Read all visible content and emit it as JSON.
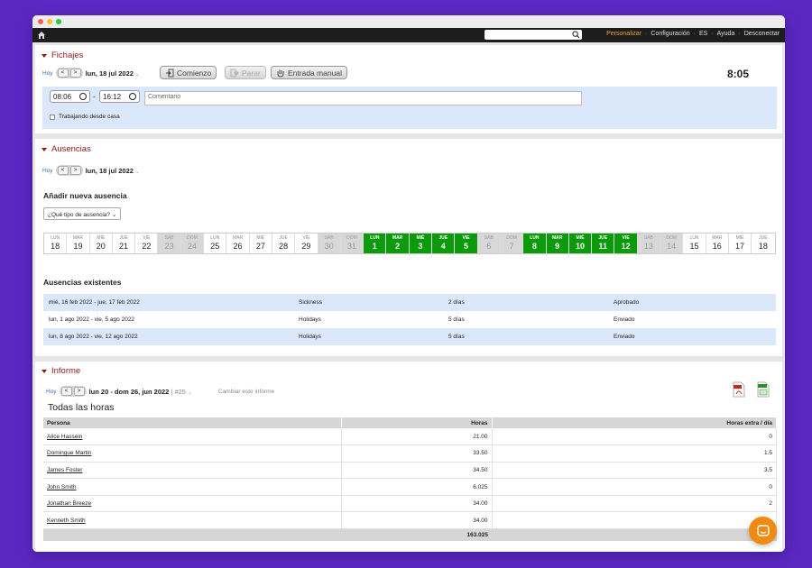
{
  "navbar": {
    "search_placeholder": "",
    "links": [
      "Personalizar",
      "Configuración",
      "ES",
      "Ayuda",
      "Desconectar"
    ],
    "separator": "·",
    "active_color": "#f0a030"
  },
  "fichajes": {
    "title": "Fichajes",
    "hoy": "Hoy",
    "prev": "<",
    "next": ">",
    "date": "lun, 18 jul 2022",
    "btn_comienzo": "Comienzo",
    "btn_parar": "Parar",
    "btn_entrada_manual": "Entrada manual",
    "clock": "8:05",
    "start_time": "08:06",
    "dash": "-",
    "end_time": "16:12",
    "comment_placeholder": "Comentario",
    "checkbox_label": "Trabajando desde casa"
  },
  "ausencias": {
    "title": "Ausencias",
    "hoy": "Hoy",
    "prev": "<",
    "next": ">",
    "date": "lun, 18 jul 2022",
    "add_heading": "Añadir nueva ausencia",
    "select_value": "¿Qué tipo de ausencia? ⌄",
    "calendar": [
      {
        "n": "LUN",
        "d": "18",
        "t": "n"
      },
      {
        "n": "MAR",
        "d": "19",
        "t": "n"
      },
      {
        "n": "MIÉ",
        "d": "20",
        "t": "n"
      },
      {
        "n": "JUE",
        "d": "21",
        "t": "n"
      },
      {
        "n": "VIE",
        "d": "22",
        "t": "n"
      },
      {
        "n": "SÁB",
        "d": "23",
        "t": "we"
      },
      {
        "n": "DOM",
        "d": "24",
        "t": "we"
      },
      {
        "n": "LUN",
        "d": "25",
        "t": "n"
      },
      {
        "n": "MAR",
        "d": "26",
        "t": "n"
      },
      {
        "n": "MIÉ",
        "d": "27",
        "t": "n"
      },
      {
        "n": "JUE",
        "d": "28",
        "t": "n"
      },
      {
        "n": "VIE",
        "d": "29",
        "t": "n"
      },
      {
        "n": "SÁB",
        "d": "30",
        "t": "we"
      },
      {
        "n": "DOM",
        "d": "31",
        "t": "we"
      },
      {
        "n": "LUN",
        "d": "1",
        "t": "sel"
      },
      {
        "n": "MAR",
        "d": "2",
        "t": "sel"
      },
      {
        "n": "MIÉ",
        "d": "3",
        "t": "sel"
      },
      {
        "n": "JUE",
        "d": "4",
        "t": "sel"
      },
      {
        "n": "VIE",
        "d": "5",
        "t": "sel"
      },
      {
        "n": "SÁB",
        "d": "6",
        "t": "we"
      },
      {
        "n": "DOM",
        "d": "7",
        "t": "we"
      },
      {
        "n": "LUN",
        "d": "8",
        "t": "sel"
      },
      {
        "n": "MAR",
        "d": "9",
        "t": "sel"
      },
      {
        "n": "MIÉ",
        "d": "10",
        "t": "sel"
      },
      {
        "n": "JUE",
        "d": "11",
        "t": "sel"
      },
      {
        "n": "VIE",
        "d": "12",
        "t": "sel"
      },
      {
        "n": "SÁB",
        "d": "13",
        "t": "we"
      },
      {
        "n": "DOM",
        "d": "14",
        "t": "we"
      },
      {
        "n": "LUN",
        "d": "15",
        "t": "n"
      },
      {
        "n": "MAR",
        "d": "16",
        "t": "n"
      },
      {
        "n": "MIÉ",
        "d": "17",
        "t": "n"
      },
      {
        "n": "JUE",
        "d": "18",
        "t": "n"
      }
    ],
    "existing_heading": "Ausencias existentes",
    "existing": [
      {
        "range": "mié, 16 feb 2022 - jue, 17 feb 2022",
        "type": "Sickness",
        "days": "2 días",
        "status": "Aprobado"
      },
      {
        "range": "lun, 1 ago 2022 - vie, 5 ago 2022",
        "type": "Holidays",
        "days": "5 días",
        "status": "Enviado"
      },
      {
        "range": "lun, 8 ago 2022 - vie, 12 ago 2022",
        "type": "Holidays",
        "days": "5 días",
        "status": "Enviado"
      }
    ]
  },
  "informe": {
    "title": "Informe",
    "hoy": "Hoy",
    "prev": "<",
    "next": ">",
    "range": "lun 20 - dom 26, jun 2022",
    "week": "| #25",
    "change_report": "Cambiar este informe",
    "subtitle": "Todas las horas",
    "columns": [
      "Persona",
      "Horas",
      "Horas extra / día"
    ],
    "rows": [
      {
        "name": "Alice Hassein",
        "hours": "21.00",
        "extra": "0"
      },
      {
        "name": "Domingue Martin",
        "hours": "33.50",
        "extra": "1.5"
      },
      {
        "name": "James Foster",
        "hours": "34.50",
        "extra": "3.5"
      },
      {
        "name": "John Smith",
        "hours": "6.025",
        "extra": "0"
      },
      {
        "name": "Jonathan Breeze",
        "hours": "34.00",
        "extra": "2"
      },
      {
        "name": "Kenneth Smith",
        "hours": "34.00",
        "extra": ""
      }
    ],
    "total": "163.025"
  }
}
